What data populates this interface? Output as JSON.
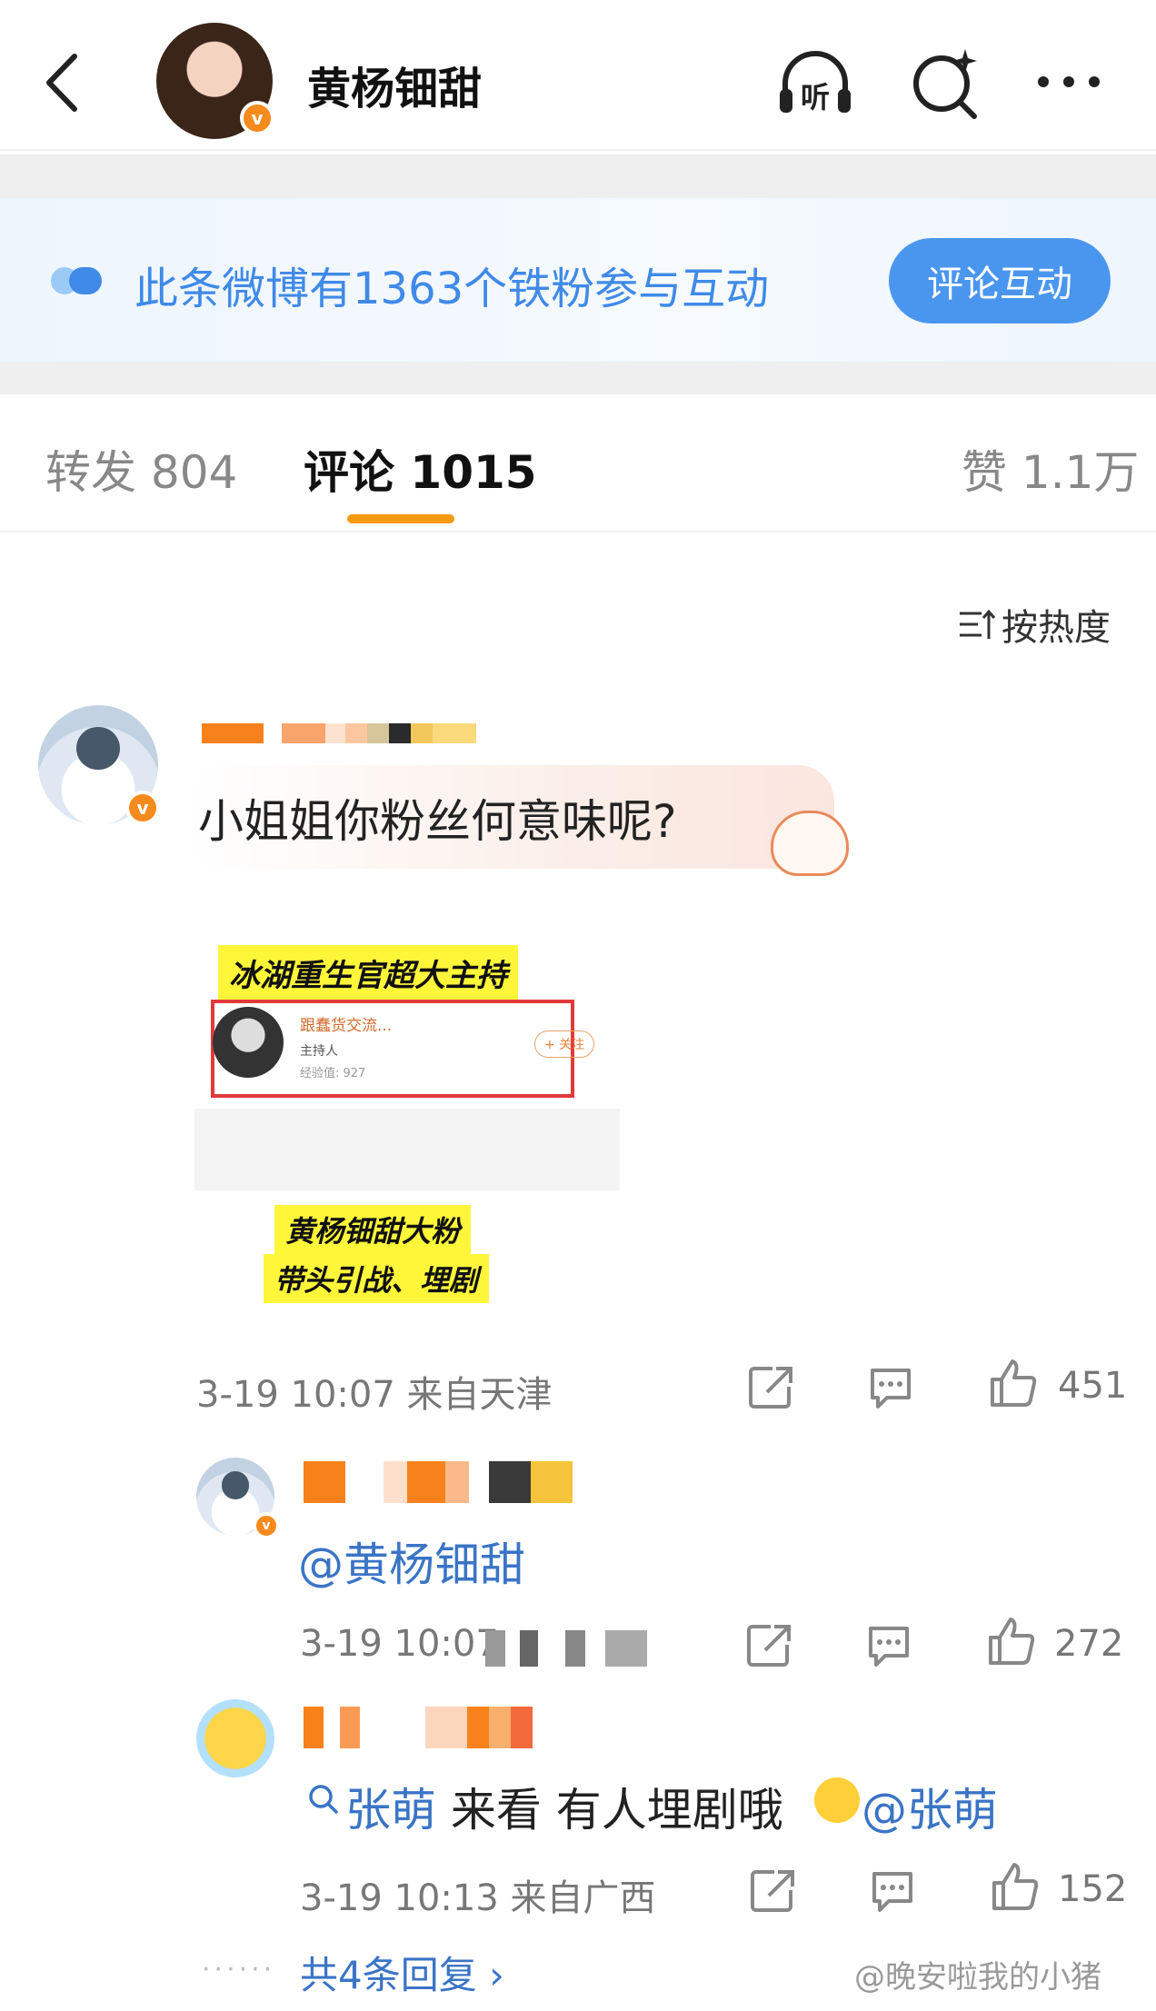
{
  "header": {
    "name": "黄杨钿甜",
    "icons": [
      "back-arrow-icon",
      "listen-icon",
      "search-sparkle-icon",
      "more-icon"
    ],
    "listen_glyph": "听",
    "verified_mark": "v"
  },
  "banner": {
    "text": "此条微博有1363个铁粉参与互动",
    "button": "评论互动"
  },
  "tabs": [
    {
      "label": "转发 804"
    },
    {
      "label": "评论 1015"
    },
    {
      "label": "赞 1.1万"
    }
  ],
  "sort": {
    "label": "按热度"
  },
  "comments": [
    {
      "text": "小姐姐你粉丝何意味呢?",
      "time_location": "3-19 10:07  来自天津",
      "likes": "451",
      "image": {
        "headline": "冰湖重生官超大主持",
        "card_name": "跟蠢货交流...",
        "card_role": "主持人",
        "card_exp": "经验值: 927",
        "follow": "+ 关注",
        "caption_line1": "黄杨钿甜大粉",
        "caption_line2": "带头引战、埋剧"
      }
    },
    {
      "text": "@黄杨钿甜",
      "time_location": "3-19 10:07",
      "likes": "272"
    },
    {
      "text_prefix": "张萌",
      "text_mid": " 来看 有人埋剧哦 ",
      "text_suffix": "@张萌",
      "time_location": "3-19 10:13  来自广西",
      "likes": "152"
    }
  ],
  "replies": {
    "label": "共4条回复 ›",
    "dots": "······"
  },
  "watermark": "@晚安啦我的小猪",
  "colors": {
    "accent": "#f59a12",
    "link": "#3a74c6",
    "banner_blue": "#4a96ef",
    "verified": "#f78a1d"
  }
}
